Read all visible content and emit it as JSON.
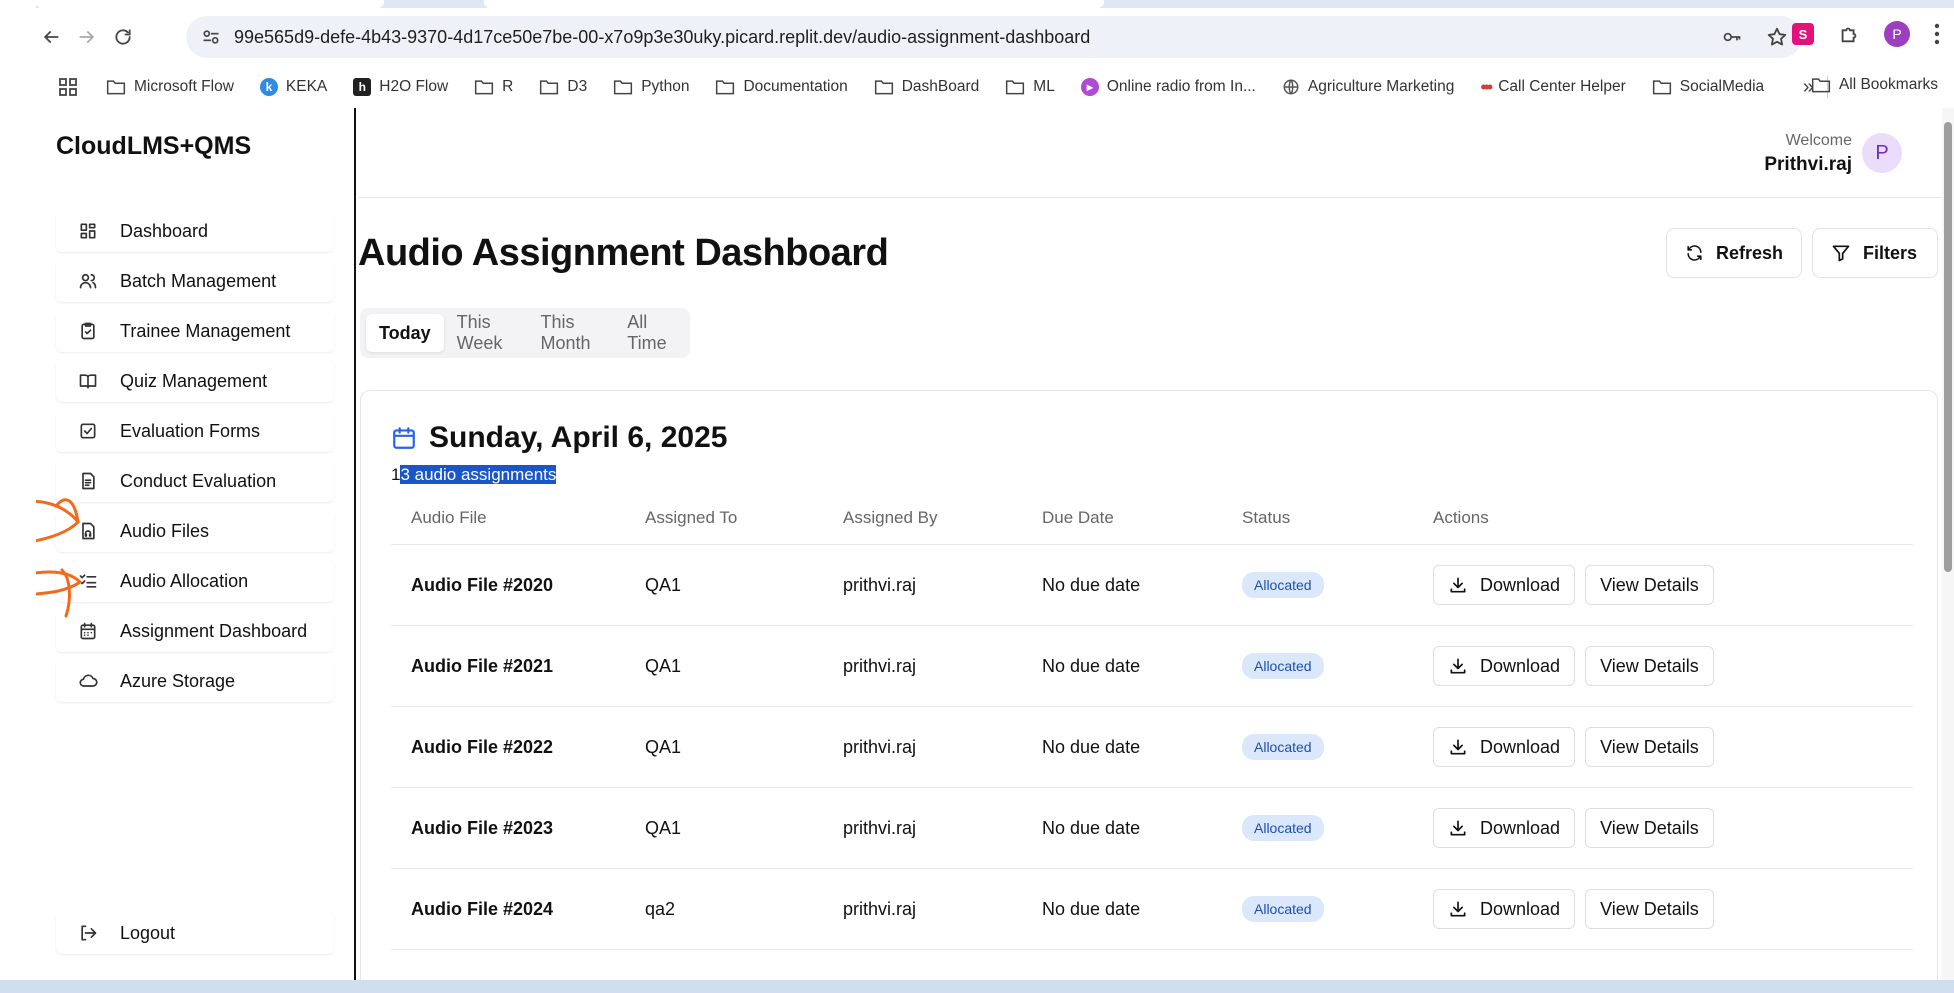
{
  "browser": {
    "url": "99e565d9-defe-4b43-9370-4d17ce50e7be-00-x7o9p3e30uky.picard.replit.dev/audio-assignment-dashboard",
    "profile_initial": "P",
    "bookmarks": [
      {
        "label": "Microsoft Flow",
        "icon": "folder-icon"
      },
      {
        "label": "KEKA",
        "icon": "keka-favicon"
      },
      {
        "label": "H2O Flow",
        "icon": "h2o-favicon"
      },
      {
        "label": "R",
        "icon": "folder-icon"
      },
      {
        "label": "D3",
        "icon": "folder-icon"
      },
      {
        "label": "Python",
        "icon": "folder-icon"
      },
      {
        "label": "Documentation",
        "icon": "folder-icon"
      },
      {
        "label": "DashBoard",
        "icon": "folder-icon"
      },
      {
        "label": "ML",
        "icon": "folder-icon"
      },
      {
        "label": "Online radio from In...",
        "icon": "radio-favicon"
      },
      {
        "label": "Agriculture Marketing",
        "icon": "globe-icon"
      },
      {
        "label": "Call Center Helper",
        "icon": "dots-favicon"
      },
      {
        "label": "SocialMedia",
        "icon": "folder-icon"
      }
    ],
    "all_bookmarks": "All Bookmarks"
  },
  "sidebar": {
    "brand": "CloudLMS+QMS",
    "items": [
      {
        "label": "Dashboard",
        "icon": "grid-icon"
      },
      {
        "label": "Batch Management",
        "icon": "users-icon"
      },
      {
        "label": "Trainee Management",
        "icon": "clipboard-icon"
      },
      {
        "label": "Quiz Management",
        "icon": "book-icon"
      },
      {
        "label": "Evaluation Forms",
        "icon": "checkbox-icon"
      },
      {
        "label": "Conduct Evaluation",
        "icon": "file-text-icon"
      },
      {
        "label": "Audio Files",
        "icon": "file-audio-icon"
      },
      {
        "label": "Audio Allocation",
        "icon": "list-checks-icon"
      },
      {
        "label": "Assignment Dashboard",
        "icon": "calendar-icon"
      },
      {
        "label": "Azure Storage",
        "icon": "cloud-icon"
      }
    ],
    "logout": "Logout"
  },
  "header": {
    "welcome": "Welcome",
    "user_name": "Prithvi.raj",
    "avatar_initial": "P"
  },
  "main": {
    "title": "Audio Assignment Dashboard",
    "refresh_label": "Refresh",
    "filters_label": "Filters",
    "tabs": [
      "Today",
      "This Week",
      "This Month",
      "All Time"
    ],
    "active_tab": "Today",
    "date_heading": "Sunday, April 6, 2025",
    "count_prefix": "1",
    "count_selected": "3 audio assignments",
    "columns": [
      "Audio File",
      "Assigned To",
      "Assigned By",
      "Due Date",
      "Status",
      "Actions"
    ],
    "rows": [
      {
        "file": "Audio File #2020",
        "assigned_to": "QA1",
        "assigned_by": "prithvi.raj",
        "due": "No due date",
        "status": "Allocated",
        "download": "Download",
        "details": "View Details"
      },
      {
        "file": "Audio File #2021",
        "assigned_to": "QA1",
        "assigned_by": "prithvi.raj",
        "due": "No due date",
        "status": "Allocated",
        "download": "Download",
        "details": "View Details"
      },
      {
        "file": "Audio File #2022",
        "assigned_to": "QA1",
        "assigned_by": "prithvi.raj",
        "due": "No due date",
        "status": "Allocated",
        "download": "Download",
        "details": "View Details"
      },
      {
        "file": "Audio File #2023",
        "assigned_to": "QA1",
        "assigned_by": "prithvi.raj",
        "due": "No due date",
        "status": "Allocated",
        "download": "Download",
        "details": "View Details"
      },
      {
        "file": "Audio File #2024",
        "assigned_to": "qa2",
        "assigned_by": "prithvi.raj",
        "due": "No due date",
        "status": "Allocated",
        "download": "Download",
        "details": "View Details"
      }
    ]
  },
  "colors": {
    "badge_bg": "#dbe8fb",
    "badge_text": "#1d4fb0",
    "selection": "#1a56c9",
    "annotation": "#f26a1b"
  }
}
